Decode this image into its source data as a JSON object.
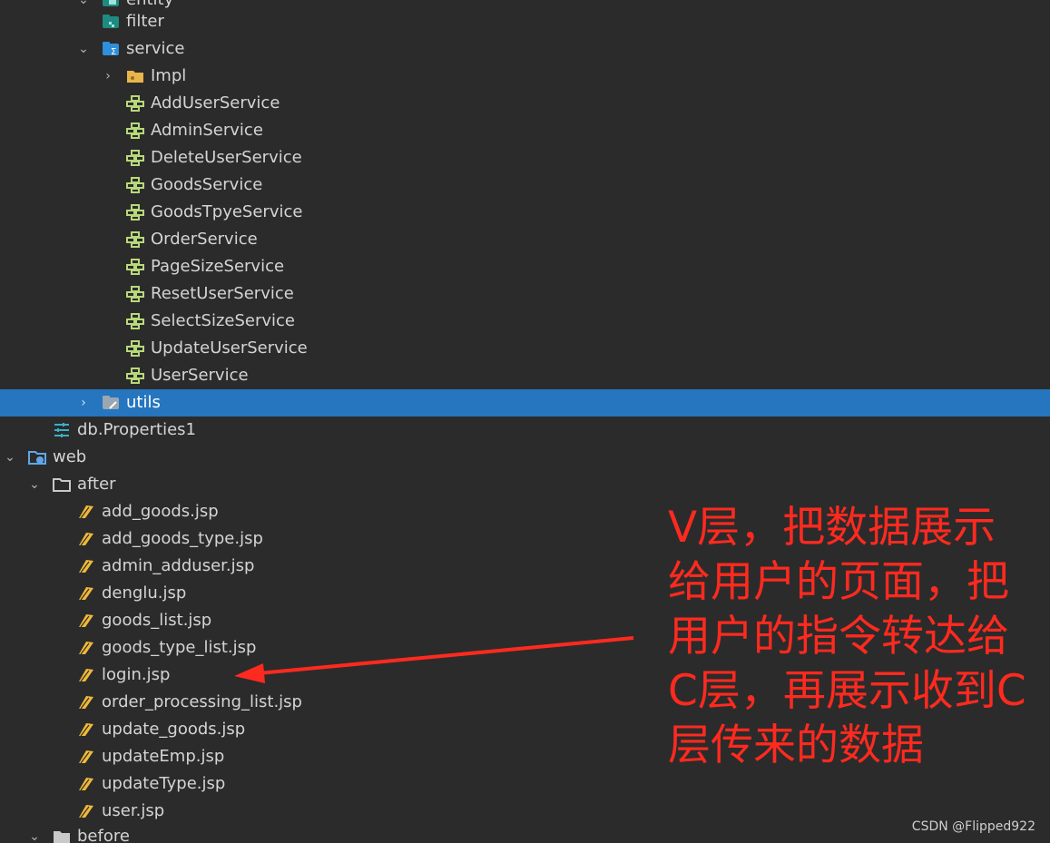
{
  "tree": {
    "rows": [
      {
        "label": "entity",
        "icon": "package-icon"
      },
      {
        "label": "filter",
        "icon": "package-icon"
      },
      {
        "label": "service",
        "icon": "package-service-icon",
        "expanded": true
      },
      {
        "label": "Impl",
        "icon": "folder-icon",
        "expanded": false
      },
      {
        "label": "AddUserService",
        "icon": "interface-icon"
      },
      {
        "label": "AdminService",
        "icon": "interface-icon"
      },
      {
        "label": "DeleteUserService",
        "icon": "interface-icon"
      },
      {
        "label": "GoodsService",
        "icon": "interface-icon"
      },
      {
        "label": "GoodsTpyeService",
        "icon": "interface-icon"
      },
      {
        "label": "OrderService",
        "icon": "interface-icon"
      },
      {
        "label": "PageSizeService",
        "icon": "interface-icon"
      },
      {
        "label": "ResetUserService",
        "icon": "interface-icon"
      },
      {
        "label": "SelectSizeService",
        "icon": "interface-icon"
      },
      {
        "label": "UpdateUserService",
        "icon": "interface-icon"
      },
      {
        "label": "UserService",
        "icon": "interface-icon"
      },
      {
        "label": "utils",
        "icon": "package-icon",
        "selected": true,
        "expanded": false
      },
      {
        "label": "db.Properties1",
        "icon": "properties-icon"
      },
      {
        "label": "web",
        "icon": "web-folder-icon",
        "expanded": true
      },
      {
        "label": "after",
        "icon": "folder-icon",
        "expanded": true
      },
      {
        "label": "add_goods.jsp",
        "icon": "jsp-icon"
      },
      {
        "label": "add_goods_type.jsp",
        "icon": "jsp-icon"
      },
      {
        "label": "admin_adduser.jsp",
        "icon": "jsp-icon"
      },
      {
        "label": "denglu.jsp",
        "icon": "jsp-icon"
      },
      {
        "label": "goods_list.jsp",
        "icon": "jsp-icon"
      },
      {
        "label": "goods_type_list.jsp",
        "icon": "jsp-icon"
      },
      {
        "label": "login.jsp",
        "icon": "jsp-icon"
      },
      {
        "label": "order_processing_list.jsp",
        "icon": "jsp-icon"
      },
      {
        "label": "update_goods.jsp",
        "icon": "jsp-icon"
      },
      {
        "label": "updateEmp.jsp",
        "icon": "jsp-icon"
      },
      {
        "label": "updateType.jsp",
        "icon": "jsp-icon"
      },
      {
        "label": "user.jsp",
        "icon": "jsp-icon"
      },
      {
        "label": "before",
        "icon": "folder-icon",
        "expanded": true
      }
    ]
  },
  "annotation": {
    "lines": [
      "V层，把数据展示",
      "给用户的页面，把",
      "用户的指令转达给",
      "C层，再展示收到C",
      "层传来的数据"
    ],
    "color": "#ff2a1f"
  },
  "watermark": "CSDN @Flipped922",
  "colors": {
    "background": "#2b2b2b",
    "selection": "#2675bf",
    "text": "#d4d4d4"
  }
}
